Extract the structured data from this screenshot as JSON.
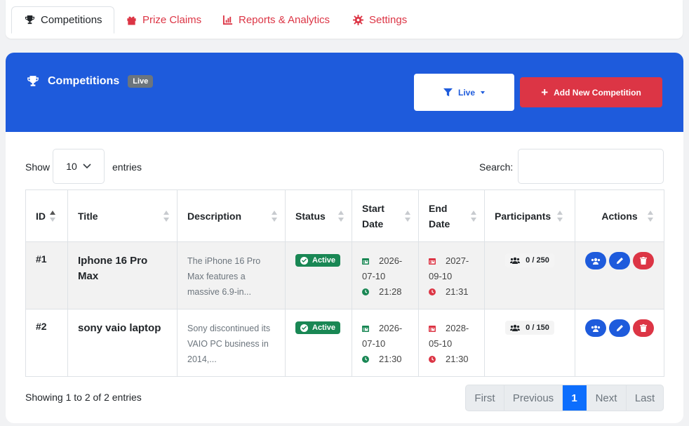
{
  "tabs": [
    {
      "label": "Competitions",
      "icon": "trophy-icon"
    },
    {
      "label": "Prize Claims",
      "icon": "gift-icon"
    },
    {
      "label": "Reports & Analytics",
      "icon": "chart-icon"
    },
    {
      "label": "Settings",
      "icon": "gear-icon"
    }
  ],
  "header": {
    "title": "Competitions",
    "badge": "Live",
    "filter_label": "Live",
    "add_label": "Add New Competition"
  },
  "controls": {
    "show_label": "Show",
    "length_value": "10",
    "entries_label": "entries",
    "search_label": "Search:",
    "search_value": ""
  },
  "table": {
    "columns": [
      "ID",
      "Title",
      "Description",
      "Status",
      "Start Date",
      "End Date",
      "Participants",
      "Actions"
    ],
    "rows": [
      {
        "id": "#1",
        "title": "Iphone 16 Pro Max",
        "description": "The iPhone 16 Pro Max features a massive 6.9-in...",
        "status": "Active",
        "start_date_1": "2026-",
        "start_date_2": "07-10",
        "start_time": "21:28",
        "end_date_1": "2027-",
        "end_date_2": "09-10",
        "end_time": "21:31",
        "participants": "0 / 250"
      },
      {
        "id": "#2",
        "title": "sony vaio laptop",
        "description": "Sony discontinued its VAIO PC business in 2014,...",
        "status": "Active",
        "start_date_1": "2026-",
        "start_date_2": "07-10",
        "start_time": "21:30",
        "end_date_1": "2028-",
        "end_date_2": "05-10",
        "end_time": "21:30",
        "participants": "0 / 150"
      }
    ]
  },
  "footer": {
    "info": "Showing 1 to 2 of 2 entries",
    "pages": [
      "First",
      "Previous",
      "1",
      "Next",
      "Last"
    ]
  },
  "colors": {
    "primary": "#1e5bdc",
    "danger": "#dc3545",
    "success": "#198754"
  }
}
